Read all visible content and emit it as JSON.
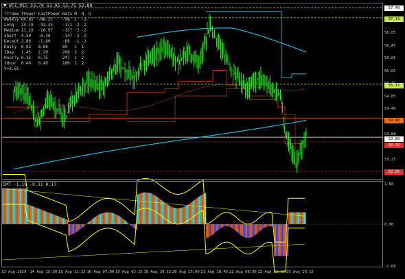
{
  "symbol_title": "WTI,M15  53.78 53.95 53.75 53.88",
  "indicator_title": "SMT -1.18 -0.31 0.17",
  "stats_table": {
    "headers": [
      "Tframe",
      "TPower",
      "FastPower",
      "Bars",
      "M",
      "H",
      "O"
    ],
    "rows": [
      [
        "Weekly",
        "64.65",
        "-48.22",
        "-98",
        "1",
        "-2",
        ""
      ],
      [
        "Long",
        "24.70",
        "-42.45",
        "-171",
        "-2",
        "-2",
        ""
      ],
      [
        "Medium",
        "11.10",
        "-10.97",
        "-157",
        "-2",
        "-2",
        ""
      ],
      [
        "Short",
        "4.50",
        "-6.38",
        "-147",
        "-2",
        "-2",
        ""
      ],
      [
        "Decent",
        "2.86",
        "-1.89",
        "-66",
        "-1",
        "-2",
        ""
      ],
      [
        "Daily",
        "0.02",
        "0.86",
        "69",
        "1",
        "1",
        ""
      ],
      [
        "IDay",
        "1.45",
        "2.20",
        "268",
        "2",
        "2",
        ""
      ],
      [
        "Hourly",
        "0.35",
        "0.75",
        "247",
        "1",
        "2",
        ""
      ],
      [
        "IHour",
        "0.40",
        "0.40",
        "100",
        "2",
        "2",
        ""
      ]
    ],
    "footer": "V=0.81"
  },
  "price_axis": [
    "57.40",
    "57.13",
    "56.85",
    "56.45",
    "56.05",
    "55.65",
    "55.32",
    "54.85",
    "54.40",
    "54.05",
    "53.88",
    "53.65",
    "53.25",
    "52.85"
  ],
  "price_boxes": [
    {
      "text": "57.40",
      "bg": "#ffffff",
      "fg": "#000000"
    },
    {
      "text": "57.13",
      "bg": "#c8e65a",
      "fg": "#000000"
    },
    {
      "text": "55.32",
      "bg": "#c8e65a",
      "fg": "#000000"
    },
    {
      "text": "54.40",
      "bg": "#ff6a00",
      "fg": "#000000"
    },
    {
      "text": "53.88",
      "bg": "#ffffff",
      "fg": "#000000"
    },
    {
      "text": "53.75",
      "bg": "#e03030",
      "fg": "#ffffff"
    },
    {
      "text": "52.95",
      "bg": "#e03030",
      "fg": "#ffffff"
    }
  ],
  "sub_axis": [
    "1.68",
    "0.00",
    "-1.68"
  ],
  "time_axis": [
    "13 Aug 2019",
    "14 Aug 15:30",
    "15 Aug 11:15",
    "16 Aug 07:00",
    "19 Aug 03:15",
    "19 Aug 19:15",
    "20 Aug 15:00",
    "21 Aug 10:45",
    "22 Aug 06:30",
    "22 Aug 22:30",
    "23 Aug 18:15"
  ],
  "colors": {
    "price": "#22dd22",
    "ma_cyan": "#29b6d6",
    "channel_orange": "#cc3300",
    "envelope_brown": "#8b3a1a",
    "level_green": "#c8e65a",
    "level_white": "#ffffff",
    "level_red": "#e03030",
    "hist_cyan": "#39d6d6",
    "hist_orange": "#ff5a00",
    "hist_yellow": "#ffff00",
    "hist_blue": "#3355ff"
  }
}
